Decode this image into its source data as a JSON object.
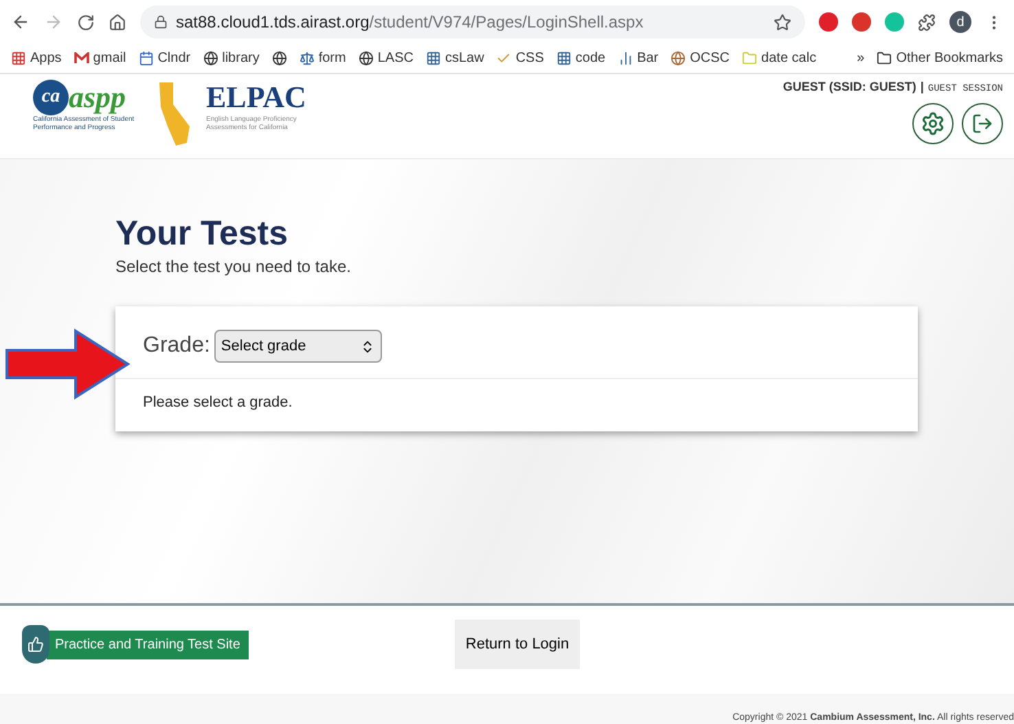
{
  "browser": {
    "url_host": "sat88.cloud1.tds.airast.org",
    "url_path": "/student/V974/Pages/LoginShell.aspx",
    "profile": "d"
  },
  "bookmarks": [
    {
      "kind": "apps",
      "label": "Apps"
    },
    {
      "kind": "gmail",
      "label": "gmail"
    },
    {
      "kind": "calendar",
      "label": "Clndr"
    },
    {
      "kind": "globe",
      "label": "library"
    },
    {
      "kind": "icon"
    },
    {
      "kind": "scale",
      "label": "form"
    },
    {
      "kind": "globe",
      "label": "LASC"
    },
    {
      "kind": "blue",
      "label": "csLaw"
    },
    {
      "kind": "check",
      "label": "CSS"
    },
    {
      "kind": "blue",
      "label": "code"
    },
    {
      "kind": "bar",
      "label": "Bar"
    },
    {
      "kind": "seal",
      "label": "OCSC"
    },
    {
      "kind": "jar",
      "label": "date calc"
    }
  ],
  "bookmarks_more": "»",
  "other_bookmarks": "Other Bookmarks",
  "header": {
    "logo_mark": "ca",
    "logo_word": "aspp",
    "logo_caption": "California Assessment of Student Performance and Progress",
    "elpac_word": "ELPAC",
    "elpac_caption": "English Language Proficiency Assessments for California",
    "user": "GUEST (SSID: GUEST)",
    "separator": "|",
    "session": "GUEST SESSION"
  },
  "page": {
    "title": "Your Tests",
    "subtitle": "Select the test you need to take.",
    "grade_label": "Grade:",
    "grade_select": "Select grade",
    "message": "Please select a grade."
  },
  "footer": {
    "practice_link": "Practice and Training Test Site",
    "return_button": "Return to Login",
    "copyright": "Copyright © 2021 **Cambium Assessment, Inc.** All rights reserved"
  }
}
